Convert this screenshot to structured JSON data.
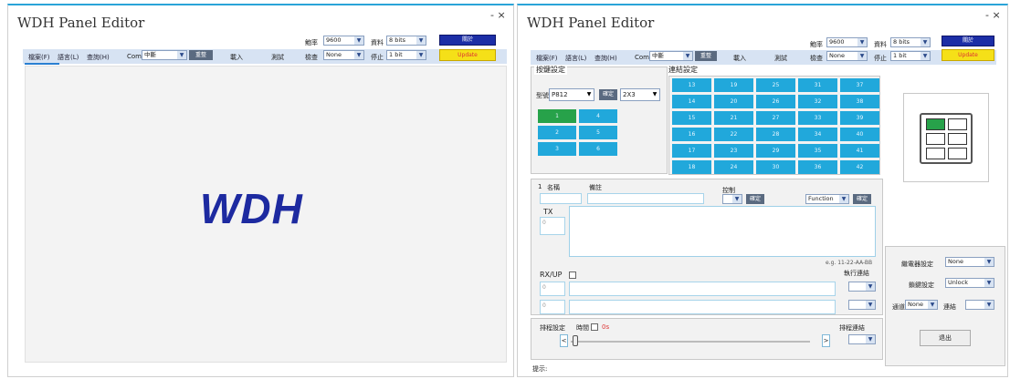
{
  "left_window": {
    "title": "WDH Panel Editor",
    "controls": "-  ×",
    "menu": [
      "檔案(F)",
      "語言(L)",
      "查詢(H)"
    ],
    "com_label": "Com",
    "com_value": "中斷",
    "reconnect": "重整",
    "load": "載入",
    "test": "測試",
    "baud_label": "鮑率",
    "baud_value": "9600",
    "data_label": "資料",
    "data_value": "8 bits",
    "parity_label": "檢查",
    "parity_value": "None",
    "stop_label": "停止",
    "stop_value": "1 bit",
    "close_btn": "關於",
    "update_btn": "Update",
    "logo": "WDH"
  },
  "right_window": {
    "title": "WDH Panel Editor",
    "controls": "-  ×",
    "menu": [
      "檔案(F)",
      "語言(L)",
      "查詢(H)"
    ],
    "com_label": "Com",
    "com_value": "中斷",
    "reconnect": "重整",
    "load": "載入",
    "test": "測試",
    "baud_label": "鮑率",
    "baud_value": "9600",
    "data_label": "資料",
    "data_value": "8 bits",
    "parity_label": "檢查",
    "parity_value": "None",
    "stop_label": "停止",
    "stop_value": "1 bit",
    "close_btn": "關於",
    "update_btn": "Update",
    "key_settings": {
      "group_title": "按鍵設定",
      "model_label": "型號",
      "model_value": "P812",
      "confirm": "確定",
      "layout_value": "2X3",
      "keys": [
        "1",
        "4",
        "2",
        "5",
        "3",
        "6"
      ]
    },
    "connection_settings": {
      "group_title": "連結設定",
      "cells": [
        "13",
        "19",
        "25",
        "31",
        "37",
        "14",
        "20",
        "26",
        "32",
        "38",
        "15",
        "21",
        "27",
        "33",
        "39",
        "16",
        "22",
        "28",
        "34",
        "40",
        "17",
        "23",
        "29",
        "35",
        "41",
        "18",
        "24",
        "30",
        "36",
        "42"
      ]
    },
    "key_detail": {
      "index": "1",
      "name_label": "名稱",
      "note_label": "備註",
      "control_label": "控制",
      "confirm1": "確定",
      "function_value": "Function",
      "confirm2": "確定",
      "tx_label": "TX",
      "tx_side": "0",
      "hint": "e.g. 11-22-AA-BB",
      "rxup_label": "RX/UP",
      "exec_label": "執行連結",
      "rx_side1": "0",
      "rx_side2": "0"
    },
    "schedule": {
      "label": "排程設定",
      "time_label": "時間",
      "time_value": "0s",
      "link_label": "排程連結",
      "left_btn": "<",
      "right_btn": ">"
    },
    "hint_label": "提示:",
    "side": {
      "relay_label": "繼電器設定",
      "relay_value": "None",
      "lock_label": "鎖鍵設定",
      "lock_value": "Unlock",
      "channel_label": "通道",
      "channel_value": "None",
      "link_label": "連結",
      "exit_btn": "退出"
    }
  }
}
